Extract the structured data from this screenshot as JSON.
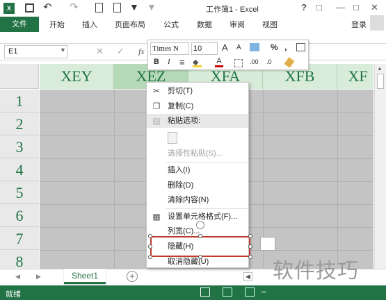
{
  "titlebar": {
    "title": "工作簿1 - Excel",
    "help": "?",
    "minimize": "—",
    "restore": "□",
    "close": "✕"
  },
  "ribbon": {
    "file": "文件",
    "tabs": [
      "开始",
      "插入",
      "页面布局",
      "公式",
      "数据",
      "审阅",
      "视图"
    ],
    "login": "登录"
  },
  "formula_bar": {
    "namebox": "E1",
    "fx": "fx"
  },
  "columns": [
    "XEY",
    "XEZ",
    "XFA",
    "XFB",
    "XF"
  ],
  "rows": [
    "1",
    "2",
    "3",
    "4",
    "5",
    "6",
    "7",
    "8"
  ],
  "mini_toolbar": {
    "font_name": "Times N",
    "font_size": "10",
    "grow": "A",
    "shrink": "A",
    "percent": "%",
    "comma": ",",
    "bold": "B",
    "italic": "I",
    "align": "≡",
    "font_color": "A",
    "dec_inc": ".00",
    "dec_dec": ".0"
  },
  "context_menu": {
    "cut": "剪切(T)",
    "copy": "复制(C)",
    "paste_options": "粘贴选项:",
    "paste_special": "选择性粘贴(S)...",
    "insert": "插入(I)",
    "delete": "删除(D)",
    "clear": "清除内容(N)",
    "format_cells": "设置单元格格式(F)...",
    "column_width": "列宽(C)...",
    "hide": "隐藏(H)",
    "unhide": "取消隐藏(U)"
  },
  "sheetbar": {
    "sheet": "Sheet1",
    "add": "+"
  },
  "statusbar": {
    "status": "就绪"
  },
  "watermark": "软件技巧",
  "colors": {
    "excel_green": "#217346",
    "header_green": "#d8ecd9",
    "cell_gray": "#c4c4c4",
    "highlight_red": "#c0392b"
  }
}
